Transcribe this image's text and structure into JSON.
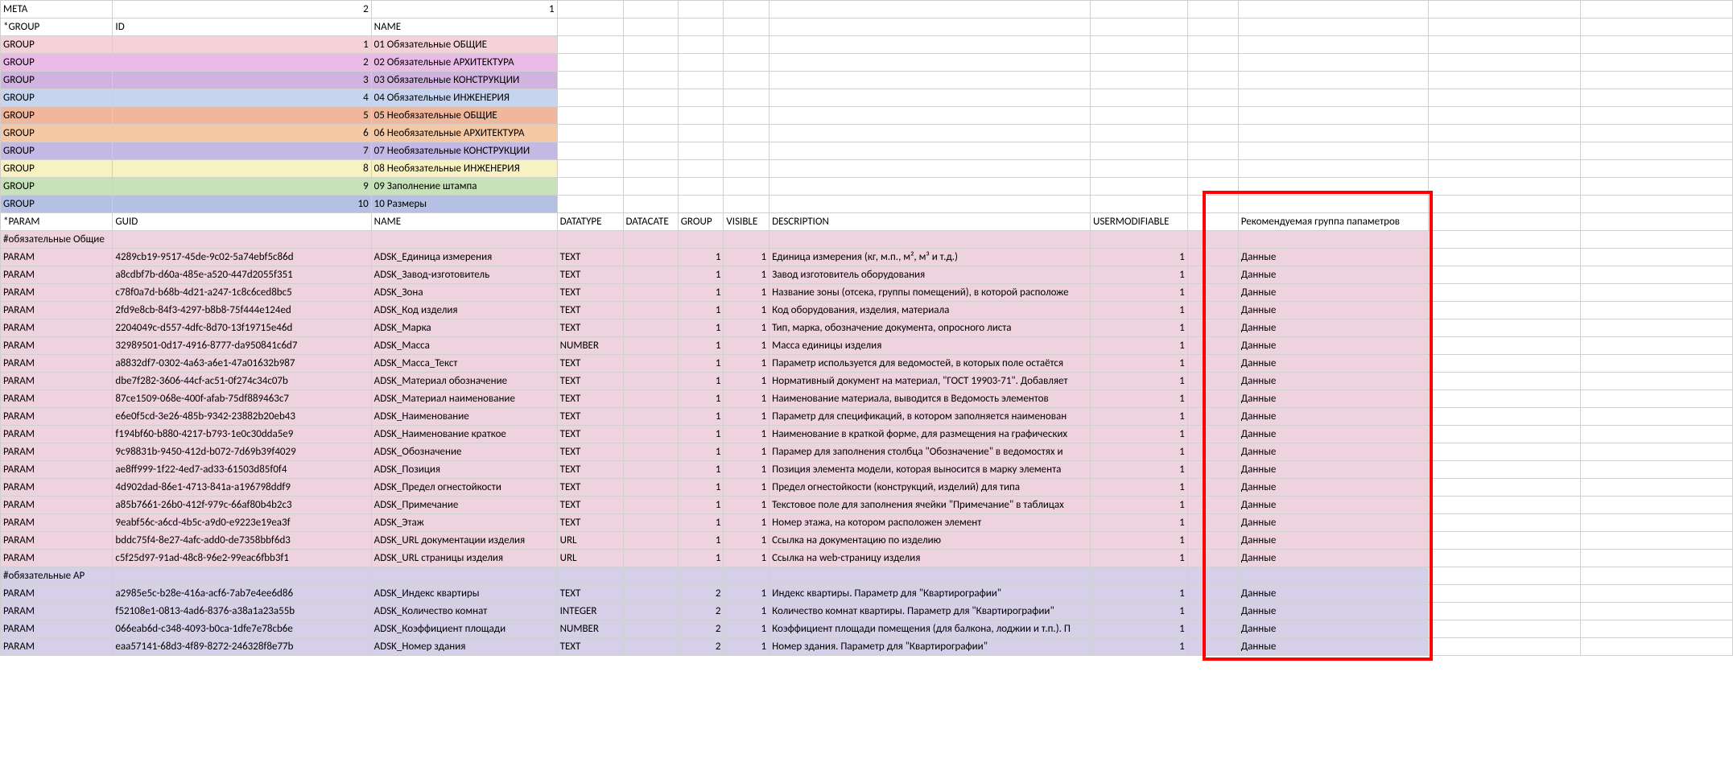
{
  "meta": {
    "a": "META",
    "b": "2",
    "c": "1"
  },
  "hdr_group": {
    "a": "*GROUP",
    "b": "ID",
    "c": "NAME"
  },
  "groups": [
    {
      "a": "GROUP",
      "id": "1",
      "name": "01 Обязательные ОБЩИЕ",
      "cls": "g1"
    },
    {
      "a": "GROUP",
      "id": "2",
      "name": "02 Обязательные АРХИТЕКТУРА",
      "cls": "g2"
    },
    {
      "a": "GROUP",
      "id": "3",
      "name": "03 Обязательные КОНСТРУКЦИИ",
      "cls": "g3"
    },
    {
      "a": "GROUP",
      "id": "4",
      "name": "04 Обязательные ИНЖЕНЕРИЯ",
      "cls": "g4"
    },
    {
      "a": "GROUP",
      "id": "5",
      "name": "05 Необязательные ОБЩИЕ",
      "cls": "g5"
    },
    {
      "a": "GROUP",
      "id": "6",
      "name": "06 Необязательные АРХИТЕКТУРА",
      "cls": "g6"
    },
    {
      "a": "GROUP",
      "id": "7",
      "name": "07 Необязательные КОНСТРУКЦИИ",
      "cls": "g7"
    },
    {
      "a": "GROUP",
      "id": "8",
      "name": "08 Необязательные ИНЖЕНЕРИЯ",
      "cls": "g8"
    },
    {
      "a": "GROUP",
      "id": "9",
      "name": "09 Заполнение штампа",
      "cls": "g9"
    },
    {
      "a": "GROUP",
      "id": "10",
      "name": "10 Размеры",
      "cls": "g10"
    }
  ],
  "hdr_param": {
    "a": "*PARAM",
    "b": "GUID",
    "c": "NAME",
    "d": "DATATYPE",
    "e": "DATACATE",
    "f": "GROUP",
    "g": "VISIBLE",
    "h": "DESCRIPTION",
    "i": "USERMODIFIABLE",
    "k": "Рекомендуемая группа папаметров"
  },
  "sec1": "#обязательные Общие",
  "params1": [
    {
      "a": "PARAM",
      "guid": "4289cb19-9517-45de-9c02-5a74ebf5c86d",
      "name": "ADSK_Единица измерения",
      "dt": "TEXT",
      "grp": "1",
      "vis": "1",
      "desc": "Единица измерения (кг, м.п., м², м³ и т.д.)",
      "um": "1",
      "rec": "Данные"
    },
    {
      "a": "PARAM",
      "guid": "a8cdbf7b-d60a-485e-a520-447d2055f351",
      "name": "ADSK_Завод-изготовитель",
      "dt": "TEXT",
      "grp": "1",
      "vis": "1",
      "desc": "Завод изготовитель оборудования",
      "um": "1",
      "rec": "Данные"
    },
    {
      "a": "PARAM",
      "guid": "c78f0a7d-b68b-4d21-a247-1c8c6ced8bc5",
      "name": "ADSK_Зона",
      "dt": "TEXT",
      "grp": "1",
      "vis": "1",
      "desc": "Название зоны (отсека, группы помещений), в которой расположе",
      "um": "1",
      "rec": "Данные"
    },
    {
      "a": "PARAM",
      "guid": "2fd9e8cb-84f3-4297-b8b8-75f444e124ed",
      "name": "ADSK_Код изделия",
      "dt": "TEXT",
      "grp": "1",
      "vis": "1",
      "desc": "Код оборудования, изделия, материала",
      "um": "1",
      "rec": "Данные"
    },
    {
      "a": "PARAM",
      "guid": "2204049c-d557-4dfc-8d70-13f19715e46d",
      "name": "ADSK_Марка",
      "dt": "TEXT",
      "grp": "1",
      "vis": "1",
      "desc": "Тип, марка, обозначение документа, опросного листа",
      "um": "1",
      "rec": "Данные"
    },
    {
      "a": "PARAM",
      "guid": "32989501-0d17-4916-8777-da950841c6d7",
      "name": "ADSK_Масса",
      "dt": "NUMBER",
      "grp": "1",
      "vis": "1",
      "desc": "Масса единицы изделия",
      "um": "1",
      "rec": "Данные"
    },
    {
      "a": "PARAM",
      "guid": "a8832df7-0302-4a63-a6e1-47a01632b987",
      "name": "ADSK_Масса_Текст",
      "dt": "TEXT",
      "grp": "1",
      "vis": "1",
      "desc": "Параметр используется для ведомостей, в которых поле остаётся",
      "um": "1",
      "rec": "Данные"
    },
    {
      "a": "PARAM",
      "guid": "dbe7f282-3606-44cf-ac51-0f274c34c07b",
      "name": "ADSK_Материал обозначение",
      "dt": "TEXT",
      "grp": "1",
      "vis": "1",
      "desc": "Нормативный документ на материал, \"ГОСТ 19903-71\". Добавляет",
      "um": "1",
      "rec": "Данные"
    },
    {
      "a": "PARAM",
      "guid": "87ce1509-068e-400f-afab-75df889463c7",
      "name": "ADSK_Материал наименование",
      "dt": "TEXT",
      "grp": "1",
      "vis": "1",
      "desc": "Наименование материала, выводится в Ведомость элементов",
      "um": "1",
      "rec": "Данные"
    },
    {
      "a": "PARAM",
      "guid": "e6e0f5cd-3e26-485b-9342-23882b20eb43",
      "name": "ADSK_Наименование",
      "dt": "TEXT",
      "grp": "1",
      "vis": "1",
      "desc": "Параметр для спецификаций, в котором заполняется наименован",
      "um": "1",
      "rec": "Данные"
    },
    {
      "a": "PARAM",
      "guid": "f194bf60-b880-4217-b793-1e0c30dda5e9",
      "name": "ADSK_Наименование краткое",
      "dt": "TEXT",
      "grp": "1",
      "vis": "1",
      "desc": "Наименование в краткой форме, для размещения на графических",
      "um": "1",
      "rec": "Данные"
    },
    {
      "a": "PARAM",
      "guid": "9c98831b-9450-412d-b072-7d69b39f4029",
      "name": "ADSK_Обозначение",
      "dt": "TEXT",
      "grp": "1",
      "vis": "1",
      "desc": "Парамер для заполнения столбца \"Обозначение\" в ведомостях и",
      "um": "1",
      "rec": "Данные"
    },
    {
      "a": "PARAM",
      "guid": "ae8ff999-1f22-4ed7-ad33-61503d85f0f4",
      "name": "ADSK_Позиция",
      "dt": "TEXT",
      "grp": "1",
      "vis": "1",
      "desc": "Позиция элемента модели, которая выносится в марку элемента",
      "um": "1",
      "rec": "Данные"
    },
    {
      "a": "PARAM",
      "guid": "4d902dad-86e1-4713-841a-a196798ddf9",
      "name": "ADSK_Предел огнестойкости",
      "dt": "TEXT",
      "grp": "1",
      "vis": "1",
      "desc": "Предел огнестойкости (конструкций, изделий) для типа",
      "um": "1",
      "rec": "Данные"
    },
    {
      "a": "PARAM",
      "guid": "a85b7661-26b0-412f-979c-66af80b4b2c3",
      "name": "ADSK_Примечание",
      "dt": "TEXT",
      "grp": "1",
      "vis": "1",
      "desc": "Текстовое поле для заполнения ячейки \"Примечание\" в таблицах",
      "um": "1",
      "rec": "Данные"
    },
    {
      "a": "PARAM",
      "guid": "9eabf56c-a6cd-4b5c-a9d0-e9223e19ea3f",
      "name": "ADSK_Этаж",
      "dt": "TEXT",
      "grp": "1",
      "vis": "1",
      "desc": "Номер этажа, на котором расположен элемент",
      "um": "1",
      "rec": "Данные"
    },
    {
      "a": "PARAM",
      "guid": "bddc75f4-8e27-4afc-add0-de7358bbf6d3",
      "name": "ADSK_URL документации изделия",
      "dt": "URL",
      "grp": "1",
      "vis": "1",
      "desc": "Ссылка на документацию по изделию",
      "um": "1",
      "rec": "Данные"
    },
    {
      "a": "PARAM",
      "guid": "c5f25d97-91ad-48c8-96e2-99eac6fbb3f1",
      "name": "ADSK_URL страницы изделия",
      "dt": "URL",
      "grp": "1",
      "vis": "1",
      "desc": "Ссылка на web-страницу изделия",
      "um": "1",
      "rec": "Данные"
    }
  ],
  "sec2": "#обязательные АР",
  "params2": [
    {
      "a": "PARAM",
      "guid": "a2985e5c-b28e-416a-acf6-7ab7e4ee6d86",
      "name": "ADSK_Индекс квартиры",
      "dt": "TEXT",
      "grp": "2",
      "vis": "1",
      "desc": "Индекс квартиры. Параметр для \"Квартирографии\"",
      "um": "1",
      "rec": "Данные"
    },
    {
      "a": "PARAM",
      "guid": "f52108e1-0813-4ad6-8376-a38a1a23a55b",
      "name": "ADSK_Количество комнат",
      "dt": "INTEGER",
      "grp": "2",
      "vis": "1",
      "desc": "Количество комнат квартиры. Параметр для \"Квартирографии\"",
      "um": "1",
      "rec": "Данные"
    },
    {
      "a": "PARAM",
      "guid": "066eab6d-c348-4093-b0ca-1dfe7e78cb6e",
      "name": "ADSK_Коэффициент площади",
      "dt": "NUMBER",
      "grp": "2",
      "vis": "1",
      "desc": "Коэффициент площади помещения (для балкона, лоджии и т.п.). П",
      "um": "1",
      "rec": "Данные"
    },
    {
      "a": "PARAM",
      "guid": "eaa57141-68d3-4f89-8272-246328f8e77b",
      "name": "ADSK_Номер здания",
      "dt": "TEXT",
      "grp": "2",
      "vis": "1",
      "desc": "Номер здания. Параметр для \"Квартирографии\"",
      "um": "1",
      "rec": "Данные"
    }
  ]
}
